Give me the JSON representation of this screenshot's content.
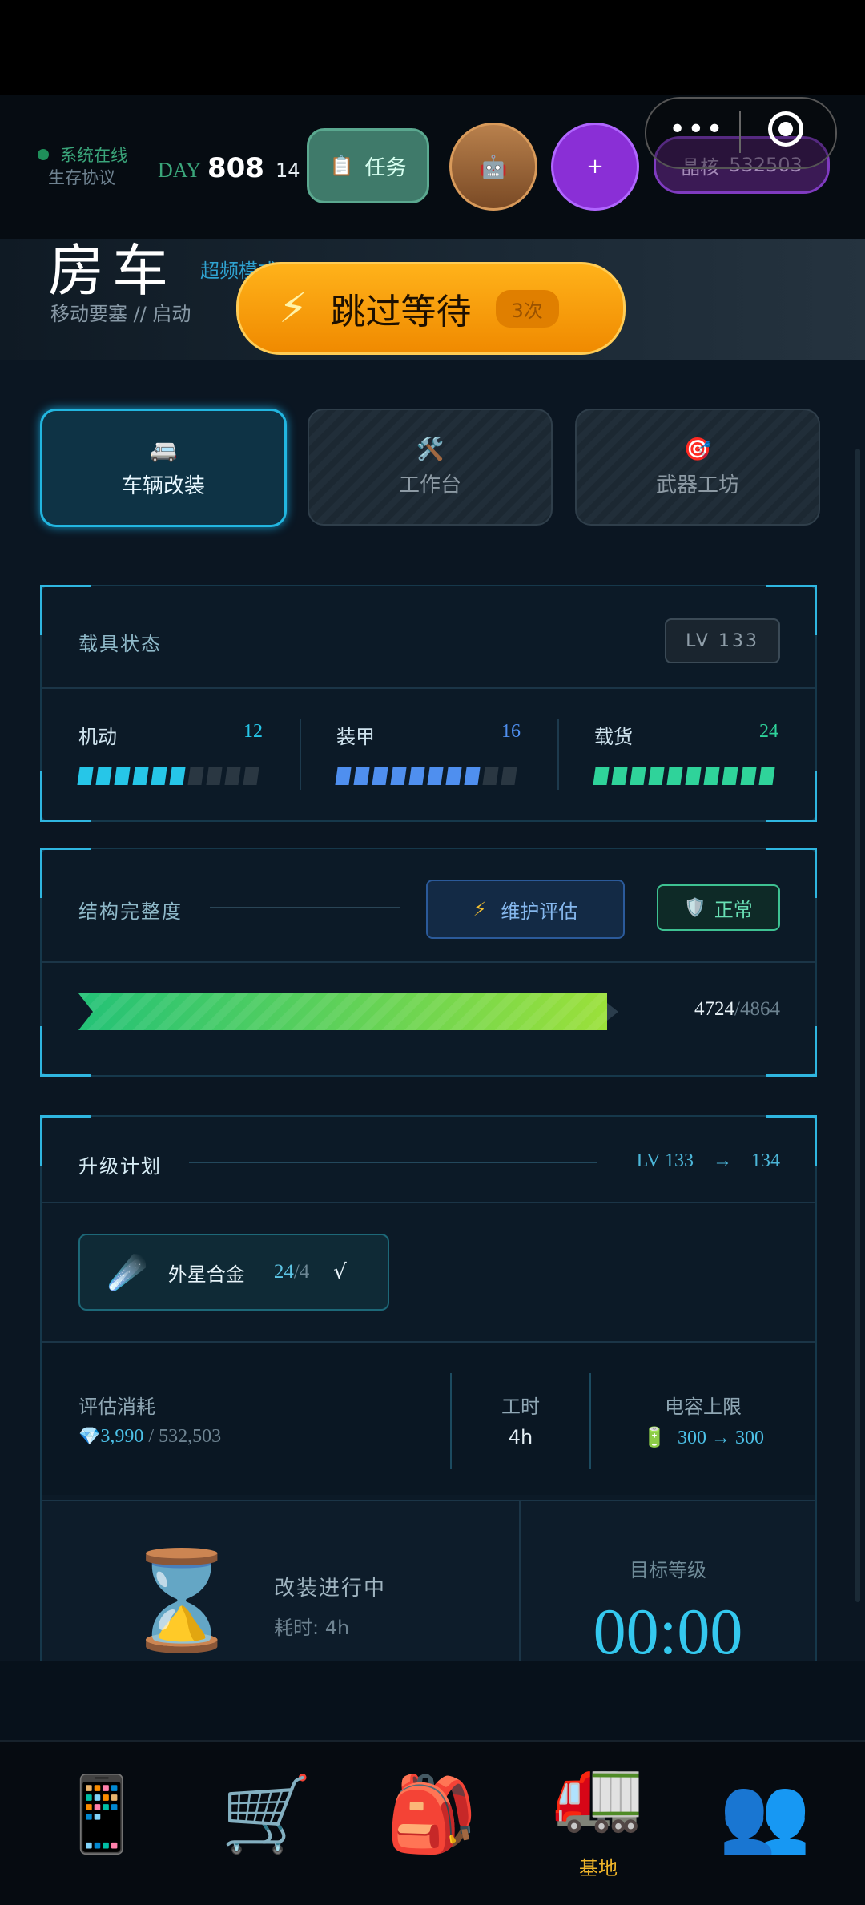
{
  "status": {
    "online": "系统在线",
    "protocol": "生存协议"
  },
  "day": {
    "label": "DAY",
    "number": "808",
    "extra": "14"
  },
  "buttons": {
    "task": "任务",
    "task_icon": "clipboard-icon",
    "robot_icon": "robot-icon",
    "plus": "+"
  },
  "crystal": {
    "label": "晶核",
    "value": "532503"
  },
  "capsule": {
    "dots": "•••"
  },
  "hero": {
    "title": "房车",
    "mode": "超频模式",
    "subtitle": "移动要塞 // 启动"
  },
  "skip": {
    "icon": "⚡",
    "label": "跳过等待",
    "count": "3次"
  },
  "tabs": [
    {
      "icon": "🚐",
      "label": "车辆改装"
    },
    {
      "icon": "🛠️",
      "label": "工作台"
    },
    {
      "icon": "🎯",
      "label": "武器工坊"
    }
  ],
  "vehicle": {
    "title": "载具状态",
    "level": "LV 133",
    "stats": [
      {
        "name": "机动",
        "value": "12",
        "filled": 6,
        "total": 10,
        "color": "#26c6e8"
      },
      {
        "name": "装甲",
        "value": "16",
        "filled": 8,
        "total": 10,
        "color": "#4f8fef"
      },
      {
        "name": "载货",
        "value": "24",
        "filled": 10,
        "total": 10,
        "color": "#2fd39a"
      }
    ]
  },
  "structure": {
    "title": "结构完整度",
    "assess_icon": "⚡",
    "assess": "维护评估",
    "badge_icon": "🛡️",
    "badge": "正常",
    "current": "4724",
    "max": "/4864",
    "fraction": 0.971
  },
  "upgrade": {
    "title": "升级计划",
    "from": "LV 133",
    "arrow": "→",
    "to": "134",
    "material": {
      "icon": "☄️",
      "name": "外星合金",
      "have": "24",
      "need": "/4",
      "check": "√"
    },
    "cost_label": "评估消耗",
    "cost_icon": "💎",
    "cost_value": "3,990",
    "cost_total": " / 532,503",
    "time_label": "工时",
    "time_value": "4h",
    "cap_label": "电容上限",
    "cap_icon": "🔋",
    "cap_value": "300 → 300"
  },
  "progress": {
    "icon": "⌛",
    "status": "改装进行中",
    "time": "耗时: 4h",
    "target_label": "目标等级",
    "timer": "00:00"
  },
  "nav": [
    {
      "icon": "📱",
      "label": ""
    },
    {
      "icon": "🛒",
      "label": ""
    },
    {
      "icon": "🎒",
      "label": ""
    },
    {
      "icon": "🚛",
      "label": "基地"
    },
    {
      "icon": "👥",
      "label": ""
    }
  ]
}
